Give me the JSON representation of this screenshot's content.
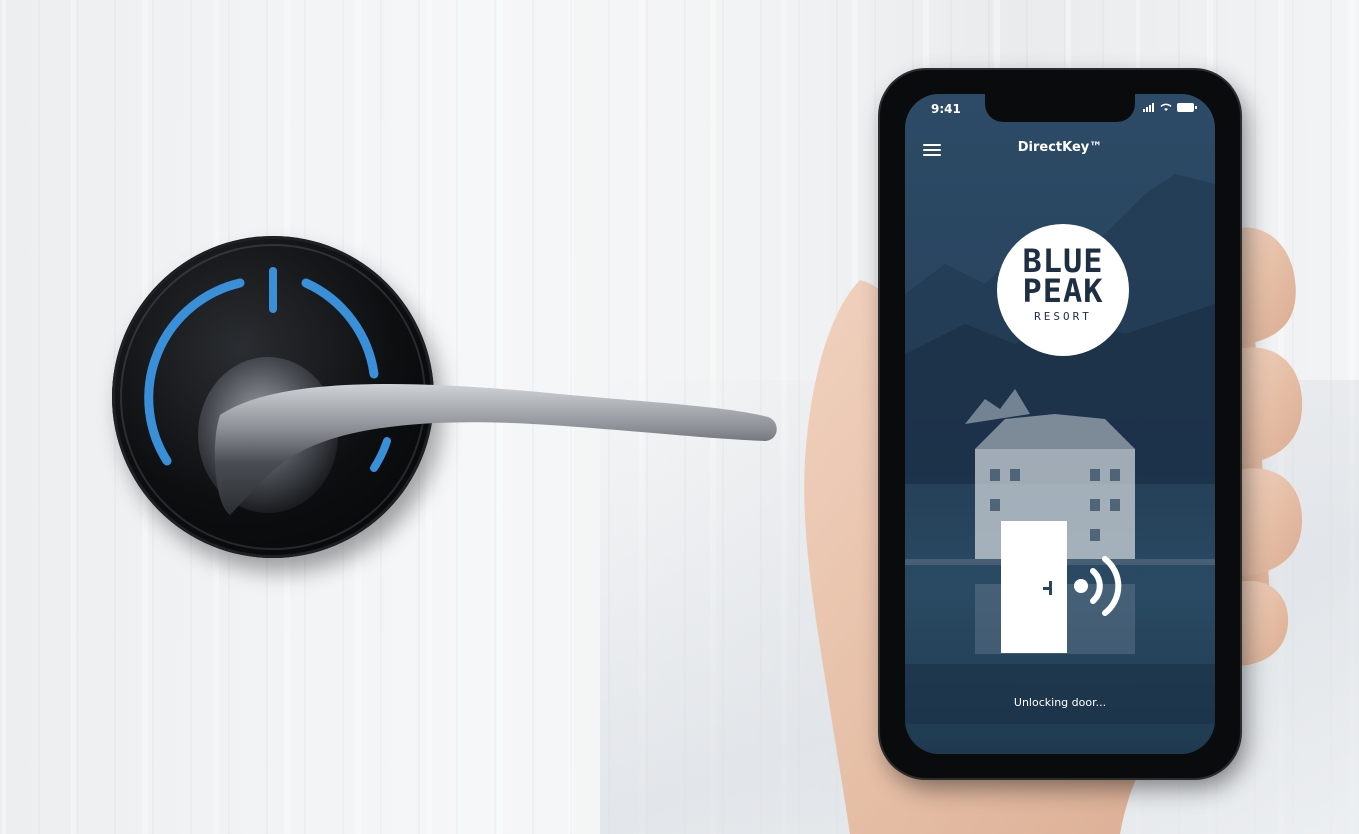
{
  "phone": {
    "status_bar": {
      "time": "9:41"
    },
    "app_title": "DirectKey™",
    "logo": {
      "line1": "BLUE",
      "line2": "PEAK",
      "line3": "RESORT"
    },
    "status": "Unlocking door..."
  },
  "colors": {
    "lock_light": "#3a8fd9",
    "screen_bg": "#294560",
    "logo_text": "#1e2f44"
  }
}
